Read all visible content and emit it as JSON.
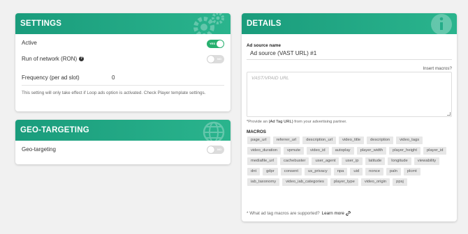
{
  "settings": {
    "title": "SETTINGS",
    "active_label": "Active",
    "active_toggle": "YES",
    "ron_label": "Run of network (RON)",
    "ron_toggle": "NO",
    "frequency_label": "Frequency (per ad slot)",
    "frequency_value": "0",
    "note": "This setting will only take effect if Loop ads option is activated. Check Player template settings."
  },
  "geo": {
    "title": "GEO-TARGETING",
    "label": "Geo-targeting",
    "toggle": "NO"
  },
  "details": {
    "title": "DETAILS",
    "ad_source_label": "Ad source name",
    "ad_source_value": "Ad source (VAST URL) #1",
    "insert_macros": "Insert macros?",
    "textarea_placeholder": "VAST/VPAID URL",
    "hint_prefix": "*Provide an",
    "hint_strong": "(Ad Tag URL)",
    "hint_suffix": "from your advertising partner.",
    "macros_label": "MACROS",
    "macros": [
      "page_url",
      "referrer_url",
      "description_url",
      "video_title",
      "description",
      "video_tags",
      "video_duration",
      "vpmute",
      "video_id",
      "autoplay",
      "player_width",
      "player_height",
      "player_id",
      "mediafile_url",
      "cachebuster",
      "user_agent",
      "user_ip",
      "latitude",
      "longitude",
      "viewability",
      "dnt",
      "gdpr",
      "consent",
      "us_privacy",
      "npa",
      "uid",
      "nonce",
      "paln",
      "plcmt",
      "iab_taxonomy",
      "video_iab_categories",
      "player_type",
      "video_origin",
      "ppsj"
    ],
    "bottom_note": "* What ad tag macros are supported?",
    "learn_more": "Learn more"
  },
  "icons": {
    "settings_header": "gears-icon",
    "geo_header": "globe-icon",
    "details_header": "info-icon",
    "help": "question-icon",
    "link": "link-icon"
  },
  "colors": {
    "header_accent": "#1f9f7f",
    "toggle_on": "#27b06f",
    "toggle_off": "#dcdcdc",
    "chip_bg": "#e7e7e7"
  }
}
